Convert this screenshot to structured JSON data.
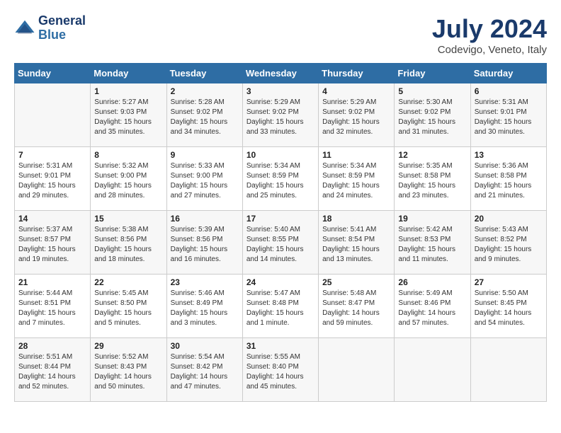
{
  "header": {
    "logo_line1": "General",
    "logo_line2": "Blue",
    "month_year": "July 2024",
    "location": "Codevigo, Veneto, Italy"
  },
  "days_of_week": [
    "Sunday",
    "Monday",
    "Tuesday",
    "Wednesday",
    "Thursday",
    "Friday",
    "Saturday"
  ],
  "weeks": [
    [
      {
        "day": "",
        "content": ""
      },
      {
        "day": "1",
        "content": "Sunrise: 5:27 AM\nSunset: 9:03 PM\nDaylight: 15 hours\nand 35 minutes."
      },
      {
        "day": "2",
        "content": "Sunrise: 5:28 AM\nSunset: 9:02 PM\nDaylight: 15 hours\nand 34 minutes."
      },
      {
        "day": "3",
        "content": "Sunrise: 5:29 AM\nSunset: 9:02 PM\nDaylight: 15 hours\nand 33 minutes."
      },
      {
        "day": "4",
        "content": "Sunrise: 5:29 AM\nSunset: 9:02 PM\nDaylight: 15 hours\nand 32 minutes."
      },
      {
        "day": "5",
        "content": "Sunrise: 5:30 AM\nSunset: 9:02 PM\nDaylight: 15 hours\nand 31 minutes."
      },
      {
        "day": "6",
        "content": "Sunrise: 5:31 AM\nSunset: 9:01 PM\nDaylight: 15 hours\nand 30 minutes."
      }
    ],
    [
      {
        "day": "7",
        "content": "Sunrise: 5:31 AM\nSunset: 9:01 PM\nDaylight: 15 hours\nand 29 minutes."
      },
      {
        "day": "8",
        "content": "Sunrise: 5:32 AM\nSunset: 9:00 PM\nDaylight: 15 hours\nand 28 minutes."
      },
      {
        "day": "9",
        "content": "Sunrise: 5:33 AM\nSunset: 9:00 PM\nDaylight: 15 hours\nand 27 minutes."
      },
      {
        "day": "10",
        "content": "Sunrise: 5:34 AM\nSunset: 8:59 PM\nDaylight: 15 hours\nand 25 minutes."
      },
      {
        "day": "11",
        "content": "Sunrise: 5:34 AM\nSunset: 8:59 PM\nDaylight: 15 hours\nand 24 minutes."
      },
      {
        "day": "12",
        "content": "Sunrise: 5:35 AM\nSunset: 8:58 PM\nDaylight: 15 hours\nand 23 minutes."
      },
      {
        "day": "13",
        "content": "Sunrise: 5:36 AM\nSunset: 8:58 PM\nDaylight: 15 hours\nand 21 minutes."
      }
    ],
    [
      {
        "day": "14",
        "content": "Sunrise: 5:37 AM\nSunset: 8:57 PM\nDaylight: 15 hours\nand 19 minutes."
      },
      {
        "day": "15",
        "content": "Sunrise: 5:38 AM\nSunset: 8:56 PM\nDaylight: 15 hours\nand 18 minutes."
      },
      {
        "day": "16",
        "content": "Sunrise: 5:39 AM\nSunset: 8:56 PM\nDaylight: 15 hours\nand 16 minutes."
      },
      {
        "day": "17",
        "content": "Sunrise: 5:40 AM\nSunset: 8:55 PM\nDaylight: 15 hours\nand 14 minutes."
      },
      {
        "day": "18",
        "content": "Sunrise: 5:41 AM\nSunset: 8:54 PM\nDaylight: 15 hours\nand 13 minutes."
      },
      {
        "day": "19",
        "content": "Sunrise: 5:42 AM\nSunset: 8:53 PM\nDaylight: 15 hours\nand 11 minutes."
      },
      {
        "day": "20",
        "content": "Sunrise: 5:43 AM\nSunset: 8:52 PM\nDaylight: 15 hours\nand 9 minutes."
      }
    ],
    [
      {
        "day": "21",
        "content": "Sunrise: 5:44 AM\nSunset: 8:51 PM\nDaylight: 15 hours\nand 7 minutes."
      },
      {
        "day": "22",
        "content": "Sunrise: 5:45 AM\nSunset: 8:50 PM\nDaylight: 15 hours\nand 5 minutes."
      },
      {
        "day": "23",
        "content": "Sunrise: 5:46 AM\nSunset: 8:49 PM\nDaylight: 15 hours\nand 3 minutes."
      },
      {
        "day": "24",
        "content": "Sunrise: 5:47 AM\nSunset: 8:48 PM\nDaylight: 15 hours\nand 1 minute."
      },
      {
        "day": "25",
        "content": "Sunrise: 5:48 AM\nSunset: 8:47 PM\nDaylight: 14 hours\nand 59 minutes."
      },
      {
        "day": "26",
        "content": "Sunrise: 5:49 AM\nSunset: 8:46 PM\nDaylight: 14 hours\nand 57 minutes."
      },
      {
        "day": "27",
        "content": "Sunrise: 5:50 AM\nSunset: 8:45 PM\nDaylight: 14 hours\nand 54 minutes."
      }
    ],
    [
      {
        "day": "28",
        "content": "Sunrise: 5:51 AM\nSunset: 8:44 PM\nDaylight: 14 hours\nand 52 minutes."
      },
      {
        "day": "29",
        "content": "Sunrise: 5:52 AM\nSunset: 8:43 PM\nDaylight: 14 hours\nand 50 minutes."
      },
      {
        "day": "30",
        "content": "Sunrise: 5:54 AM\nSunset: 8:42 PM\nDaylight: 14 hours\nand 47 minutes."
      },
      {
        "day": "31",
        "content": "Sunrise: 5:55 AM\nSunset: 8:40 PM\nDaylight: 14 hours\nand 45 minutes."
      },
      {
        "day": "",
        "content": ""
      },
      {
        "day": "",
        "content": ""
      },
      {
        "day": "",
        "content": ""
      }
    ]
  ]
}
